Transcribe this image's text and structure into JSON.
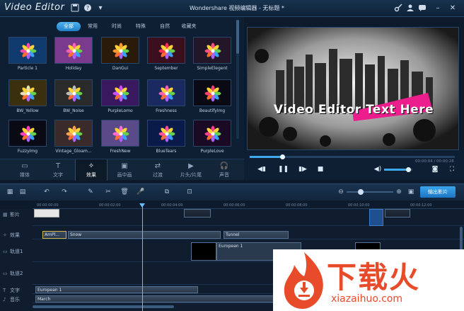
{
  "app": {
    "title": "Video Editor",
    "window_title": "Wondershare 视频编辑器 - 无标题 *"
  },
  "effects": {
    "tabs": [
      "全部",
      "常用",
      "时尚",
      "特殊",
      "自然",
      "收藏夹"
    ],
    "active_tab": 0,
    "items": [
      {
        "label": "Particle 1",
        "bg": "#0f3a6e",
        "petal": "#ff4aa8"
      },
      {
        "label": "Holiday",
        "bg": "#7a3a8e",
        "petal": "#ff60b0"
      },
      {
        "label": "DanGui",
        "bg": "#2a1a0a",
        "petal": "#ff9a30"
      },
      {
        "label": "September",
        "bg": "#3a1020",
        "petal": "#ff3050"
      },
      {
        "label": "SimpleElegent",
        "bg": "#231628",
        "petal": "#ff5080"
      },
      {
        "label": "BW_Yellow",
        "bg": "#3a3010",
        "petal": "#e8e0b0"
      },
      {
        "label": "BW_Noise",
        "bg": "#2a2a2a",
        "petal": "#bcbcbc"
      },
      {
        "label": "PurpleLomo",
        "bg": "#3a1860",
        "petal": "#d050ff"
      },
      {
        "label": "Freshness",
        "bg": "#1a2a60",
        "petal": "#ff60b0"
      },
      {
        "label": "BeautifyImg",
        "bg": "#0a0a14",
        "petal": "#ff4070"
      },
      {
        "label": "FuzzyImg",
        "bg": "#0a0a14",
        "petal": "#ff40c0"
      },
      {
        "label": "Vintage_Gloam...",
        "bg": "#3a2a2a",
        "petal": "#ffa050"
      },
      {
        "label": "FreshNew",
        "bg": "#5a4a8a",
        "petal": "#ff70d0"
      },
      {
        "label": "BlueTears",
        "bg": "#0a1a4a",
        "petal": "#ff50a0"
      },
      {
        "label": "PurpleLove",
        "bg": "#1a0a24",
        "petal": "#ff4090"
      }
    ]
  },
  "modules": [
    {
      "label": "媒体",
      "icon": "media-icon"
    },
    {
      "label": "文字",
      "icon": "text-icon"
    },
    {
      "label": "效果",
      "icon": "magic-wand-icon"
    },
    {
      "label": "画中画",
      "icon": "pip-icon"
    },
    {
      "label": "过渡",
      "icon": "transition-icon"
    },
    {
      "label": "片头/片尾",
      "icon": "intro-icon"
    },
    {
      "label": "声音",
      "icon": "headphones-icon"
    }
  ],
  "active_module": 2,
  "preview": {
    "text": "Video Editor Text Here",
    "time": "00:00:04 / 00:00:28",
    "progress": 0.16,
    "volume": 0.85
  },
  "timeline": {
    "export_label": "输出影片",
    "zoom_level": 0.3,
    "ruler": [
      "00:00:00:00",
      "00:00:02:00",
      "00:00:04:00",
      "00:00:06:00",
      "00:00:08:00",
      "00:00:10:00",
      "00:00:12:00"
    ],
    "tracks": [
      {
        "label": "影片",
        "icon": "film-icon"
      },
      {
        "label": "效果",
        "icon": "effect-icon"
      },
      {
        "label": "轨道1",
        "icon": "track-icon"
      },
      {
        "label": "轨道2",
        "icon": "track-icon"
      },
      {
        "label": "文字",
        "icon": "text-t-icon"
      },
      {
        "label": "音乐",
        "icon": "music-icon"
      }
    ],
    "effect_clips": [
      "AmPl...",
      "Snow",
      "Tunnel"
    ],
    "track1_clip": "European 1",
    "text_clip": "European 1",
    "music_clip": "March"
  },
  "watermark": {
    "text": "下载火",
    "url": "xiazaihuo.com"
  },
  "colors": {
    "accent": "#3fa8e8",
    "background": "#0f1f33",
    "watermark": "#e84b2a"
  }
}
